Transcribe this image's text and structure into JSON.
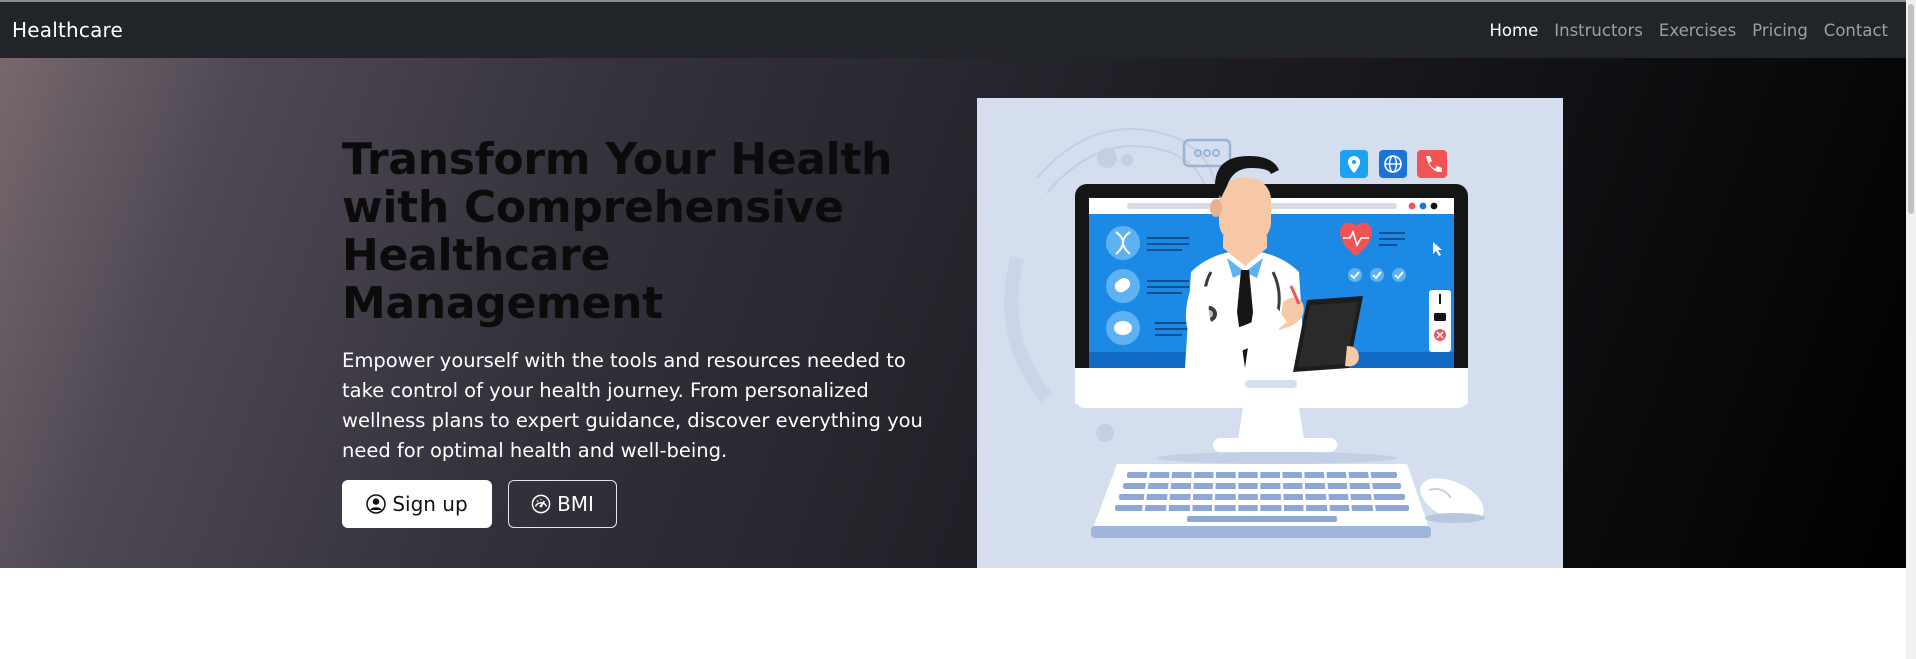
{
  "navbar": {
    "brand": "Healthcare",
    "links": [
      {
        "label": "Home",
        "active": true
      },
      {
        "label": "Instructors",
        "active": false
      },
      {
        "label": "Exercises",
        "active": false
      },
      {
        "label": "Pricing",
        "active": false
      },
      {
        "label": "Contact",
        "active": false
      }
    ]
  },
  "hero": {
    "headline": "Transform Your Health with Comprehensive Healthcare Management",
    "lead": "Empower yourself with the tools and resources needed to take control of your health journey. From personalized wellness plans to expert guidance, discover everything you need for optimal health and well-being.",
    "buttons": {
      "signup_label": "Sign up",
      "signup_icon": "person-circle-icon",
      "bmi_label": "BMI",
      "bmi_icon": "speedometer-icon"
    },
    "illustration": "doctor-on-computer-illustration"
  },
  "colors": {
    "navbar_bg": "#212529",
    "hero_gradient_start": "#77686d",
    "hero_gradient_end": "#000000",
    "illustration_bg": "#d5deee",
    "screen_blue": "#1c8ae4"
  }
}
